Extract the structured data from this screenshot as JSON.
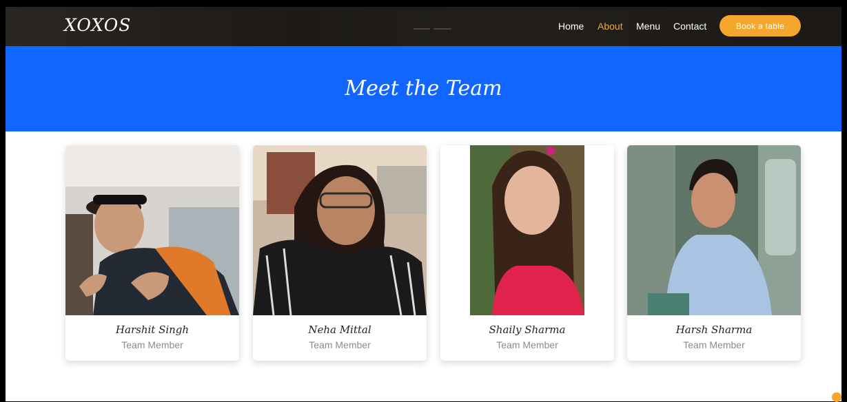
{
  "header": {
    "logo": "XOXOS",
    "nav": [
      {
        "label": "Home",
        "active": false
      },
      {
        "label": "About",
        "active": true
      },
      {
        "label": "Menu",
        "active": false
      },
      {
        "label": "Contact",
        "active": false
      }
    ],
    "book_button": "Book a table"
  },
  "banner": {
    "title": "Meet the Team"
  },
  "team": [
    {
      "name": "Harshit Singh",
      "role": "Team Member"
    },
    {
      "name": "Neha Mittal",
      "role": "Team Member"
    },
    {
      "name": "Shaily Sharma",
      "role": "Team Member"
    },
    {
      "name": "Harsh Sharma",
      "role": "Team Member"
    }
  ],
  "colors": {
    "banner_blue": "#1166ff",
    "accent_orange": "#f4a72c",
    "header_dark": "#1f1c19"
  }
}
